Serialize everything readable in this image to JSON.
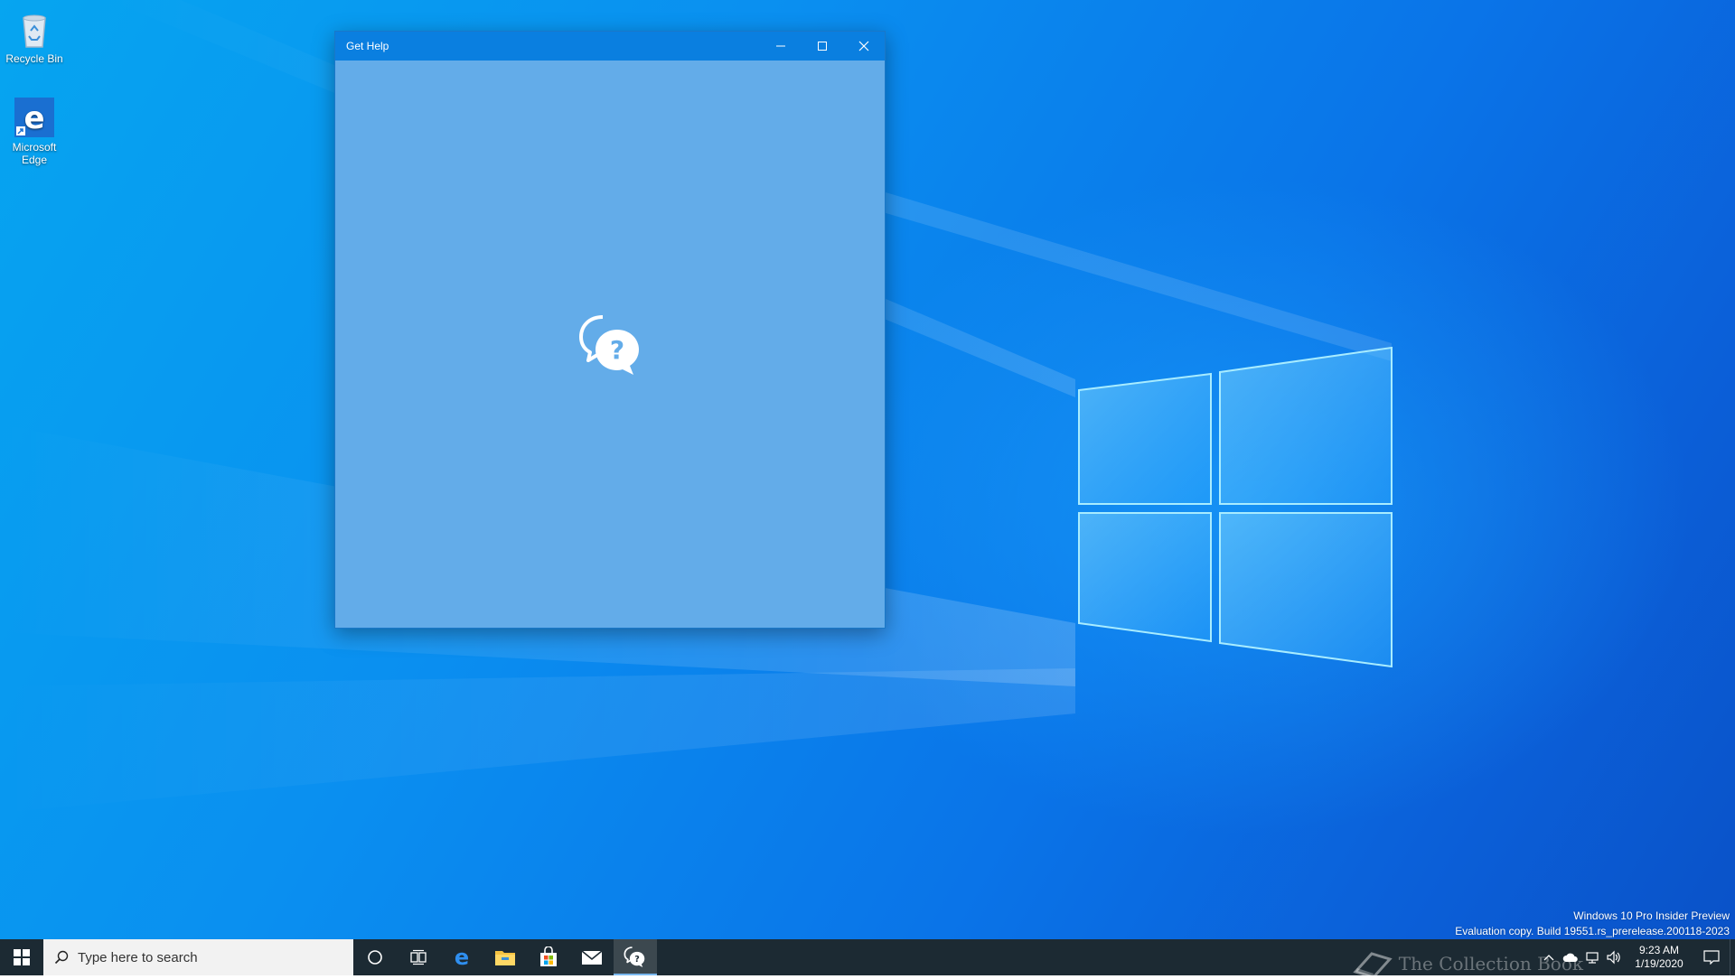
{
  "desktop": {
    "icons": [
      {
        "label": "Recycle Bin",
        "icon": "recycle-bin-icon"
      },
      {
        "label": "Microsoft Edge",
        "icon": "edge-icon"
      }
    ],
    "eval_line1": "Windows 10 Pro Insider Preview",
    "eval_line2": "Evaluation copy. Build 19551.rs_prerelease.200118-2023",
    "watermark": "The Collection Book"
  },
  "window": {
    "title": "Get Help",
    "minimize_icon": "minimize-icon",
    "maximize_icon": "maximize-icon",
    "close_icon": "close-icon",
    "splash_icon": "get-help-icon",
    "body_color": "#63ace9",
    "titlebar_color": "#0a7fe0"
  },
  "taskbar": {
    "search_placeholder": "Type here to search",
    "apps": [
      {
        "name": "cortana",
        "icon": "cortana-icon"
      },
      {
        "name": "task-view",
        "icon": "task-view-icon"
      },
      {
        "name": "edge",
        "icon": "edge-icon"
      },
      {
        "name": "file-explorer",
        "icon": "folder-icon"
      },
      {
        "name": "store",
        "icon": "store-icon"
      },
      {
        "name": "mail",
        "icon": "mail-icon"
      },
      {
        "name": "get-help",
        "icon": "get-help-icon",
        "active": true
      }
    ],
    "clock_time": "9:23 AM",
    "clock_date": "1/19/2020",
    "background": "#1c2a33"
  }
}
